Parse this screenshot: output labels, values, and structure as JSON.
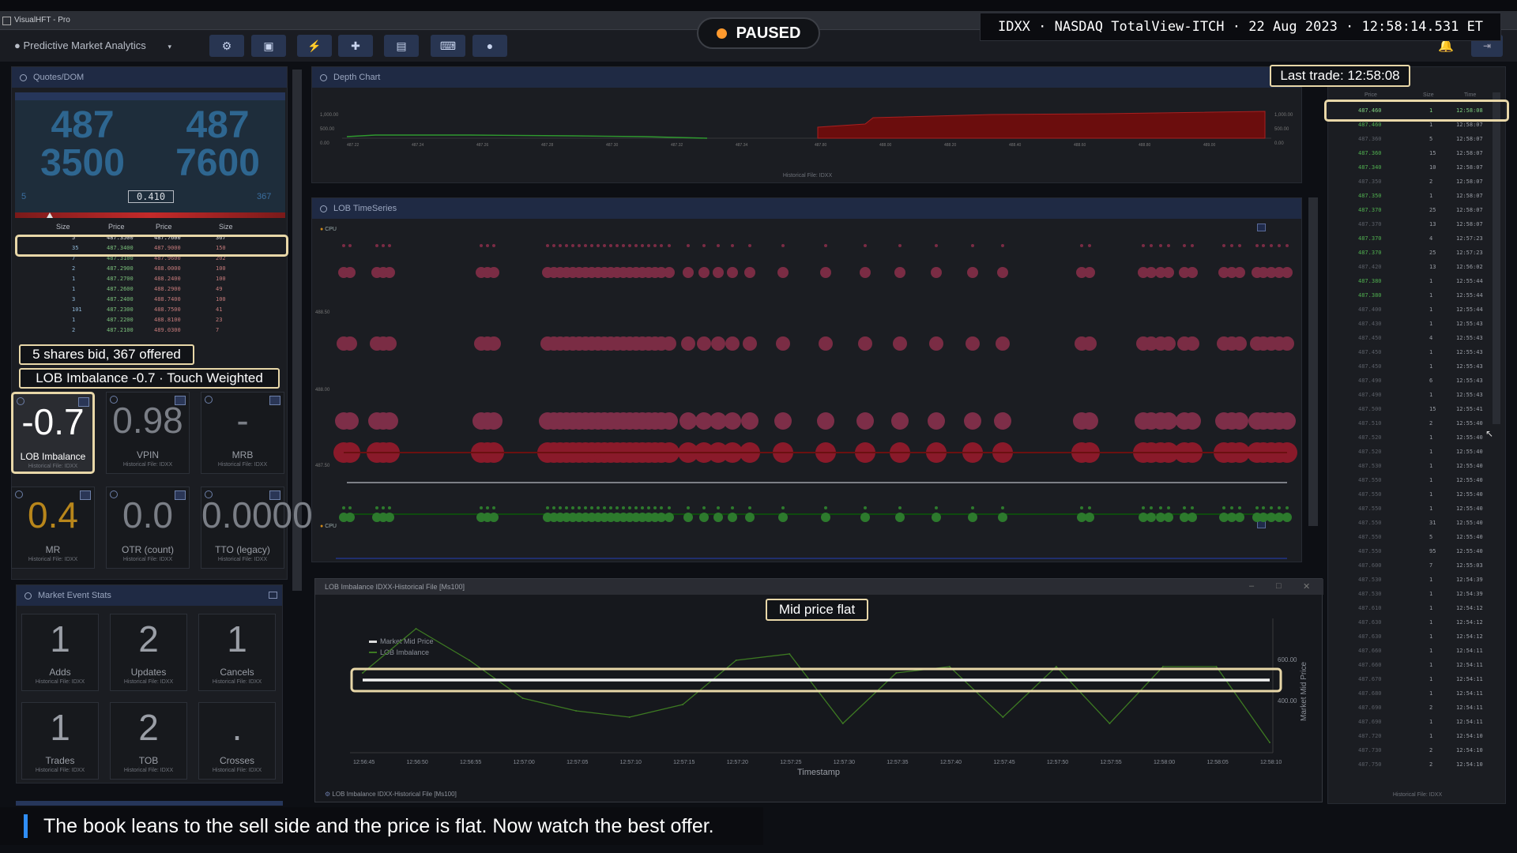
{
  "window": {
    "title": "VisualHFT - Pro"
  },
  "toolbar": {
    "app_name": "Predictive Market Analytics",
    "buttons": [
      "gear-icon",
      "monitor-icon",
      "bolt-icon",
      "puzzle-icon",
      "chart-icon",
      "keyboard-icon",
      "user-icon"
    ]
  },
  "status": {
    "paused_label": "PAUSED",
    "info_bar": "IDXX · NASDAQ TotalView-ITCH · 22 Aug 2023 · 12:58:14.531 ET",
    "dot_color": "#ff9a2e"
  },
  "quotes": {
    "title": "Quotes/DOM",
    "bid_price_top": "487",
    "bid_price_bottom": "3500",
    "ask_price_top": "487",
    "ask_price_bottom": "7600",
    "spread": "0.410",
    "bid_size": "5",
    "ask_size": "367",
    "headers": [
      "Size",
      "Price",
      "Price",
      "Size"
    ],
    "rows": [
      [
        "5",
        "487.3500",
        "487.7600",
        "367"
      ],
      [
        "35",
        "487.3400",
        "487.9000",
        "150"
      ],
      [
        "7",
        "487.3100",
        "487.9600",
        "202"
      ],
      [
        "2",
        "487.2900",
        "488.0000",
        "100"
      ],
      [
        "1",
        "487.2700",
        "488.2400",
        "100"
      ],
      [
        "1",
        "487.2600",
        "488.2900",
        "49"
      ],
      [
        "3",
        "487.2400",
        "488.7400",
        "100"
      ],
      [
        "101",
        "487.2300",
        "488.7500",
        "41"
      ],
      [
        "1",
        "487.2200",
        "488.8100",
        "23"
      ],
      [
        "2",
        "487.2100",
        "489.0300",
        "7"
      ]
    ]
  },
  "callouts": {
    "quotes_note": "5 shares bid, 367 offered",
    "lob_note": "LOB Imbalance -0.7 · Touch Weighted",
    "last_trade": "Last trade: 12:58:08",
    "mid_flat": "Mid price flat"
  },
  "metrics": [
    {
      "value": "-0.7",
      "label": "LOB Imbalance",
      "source": "Historical File: IDXX",
      "color": "#ffffff"
    },
    {
      "value": "0.98",
      "label": "VPIN",
      "source": "Historical File: IDXX",
      "color": "#7a7e86"
    },
    {
      "value": "-",
      "label": "MRB",
      "source": "Historical File: IDXX",
      "color": "#7a7e86"
    },
    {
      "value": "0.4",
      "label": "MR",
      "source": "Historical File: IDXX",
      "color": "#b8861b"
    },
    {
      "value": "0.0",
      "label": "OTR (count)",
      "source": "Historical File: IDXX",
      "color": "#7a7e86"
    },
    {
      "value": "0.0000",
      "label": "TTO (legacy)",
      "source": "Historical File: IDXX",
      "color": "#7a7e86"
    }
  ],
  "market_stats": {
    "title": "Market Event Stats",
    "items": [
      {
        "value": "1",
        "label": "Adds",
        "source": "Historical File: IDXX"
      },
      {
        "value": "2",
        "label": "Updates",
        "source": "Historical File: IDXX"
      },
      {
        "value": "1",
        "label": "Cancels",
        "source": "Historical File: IDXX"
      },
      {
        "value": "1",
        "label": "Trades",
        "source": "Historical File: IDXX"
      },
      {
        "value": "2",
        "label": "TOB",
        "source": "Historical File: IDXX"
      },
      {
        "value": ".",
        "label": "Crosses",
        "source": "Historical File: IDXX"
      }
    ]
  },
  "depth": {
    "title": "Depth Chart",
    "source": "Historical File: IDXX",
    "y_ticks": [
      "1,000.00",
      "500.00",
      "0.00"
    ],
    "x_ticks": [
      "487.22",
      "487.24",
      "487.26",
      "487.28",
      "487.30",
      "487.32",
      "487.34",
      "487.80",
      "488.00",
      "488.20",
      "488.40",
      "488.60",
      "488.80",
      "489.00"
    ]
  },
  "lob_ts": {
    "title": "LOB TimeSeries",
    "badge": "CPU",
    "y_ticks": [
      "488.50",
      "488.00",
      "487.50"
    ]
  },
  "imbalance_chart": {
    "window_title": "LOB Imbalance IDXX-Historical File [Ms100]",
    "footer": "LOB Imbalance IDXX-Historical File [Ms100]",
    "legend": [
      "Market Mid Price",
      "LOB Imbalance"
    ],
    "xlabel": "Timestamp",
    "ylabel_right": "Market Mid Price",
    "y_ticks_right": [
      "600.00",
      "400.00"
    ],
    "x_ticks": [
      "12:56:45",
      "12:56:50",
      "12:56:55",
      "12:57:00",
      "12:57:05",
      "12:57:10",
      "12:57:15",
      "12:57:20",
      "12:57:25",
      "12:57:30",
      "12:57:35",
      "12:57:40",
      "12:57:45",
      "12:57:50",
      "12:57:55",
      "12:58:00",
      "12:58:05",
      "12:58:10"
    ]
  },
  "chart_data": {
    "type": "line",
    "xlabel": "Timestamp",
    "ylabel": "Market Mid Price",
    "x": [
      "12:56:45",
      "12:56:50",
      "12:56:55",
      "12:57:00",
      "12:57:05",
      "12:57:10",
      "12:57:15",
      "12:57:20",
      "12:57:25",
      "12:57:30",
      "12:57:35",
      "12:57:40",
      "12:57:45",
      "12:57:50",
      "12:57:55",
      "12:58:00",
      "12:58:05",
      "12:58:10"
    ],
    "series": [
      {
        "name": "Market Mid Price",
        "values": [
          487.55,
          487.55,
          487.55,
          487.55,
          487.55,
          487.55,
          487.55,
          487.55,
          487.55,
          487.55,
          487.55,
          487.55,
          487.55,
          487.55,
          487.55,
          487.55,
          487.55,
          487.55
        ]
      },
      {
        "name": "LOB Imbalance",
        "values": [
          0.2,
          0.9,
          0.4,
          -0.2,
          -0.4,
          -0.5,
          -0.3,
          0.4,
          0.5,
          -0.6,
          0.2,
          0.3,
          -0.5,
          0.3,
          -0.6,
          0.3,
          0.3,
          -0.9
        ]
      }
    ]
  },
  "trades": {
    "headers": [
      "Price",
      "Size",
      "Time"
    ],
    "footer": "Historical File: IDXX",
    "rows": [
      [
        "487.460",
        "1",
        "12:58:08"
      ],
      [
        "487.460",
        "1",
        "12:58:07"
      ],
      [
        "487.360",
        "5",
        "12:58:07"
      ],
      [
        "487.360",
        "15",
        "12:58:07"
      ],
      [
        "487.340",
        "10",
        "12:58:07"
      ],
      [
        "487.350",
        "2",
        "12:58:07"
      ],
      [
        "487.350",
        "1",
        "12:58:07"
      ],
      [
        "487.370",
        "25",
        "12:58:07"
      ],
      [
        "487.370",
        "13",
        "12:58:07"
      ],
      [
        "487.370",
        "4",
        "12:57:23"
      ],
      [
        "487.370",
        "25",
        "12:57:23"
      ],
      [
        "487.420",
        "13",
        "12:56:02"
      ],
      [
        "487.380",
        "1",
        "12:55:44"
      ],
      [
        "487.380",
        "1",
        "12:55:44"
      ],
      [
        "487.400",
        "1",
        "12:55:44"
      ],
      [
        "487.430",
        "1",
        "12:55:43"
      ],
      [
        "487.450",
        "4",
        "12:55:43"
      ],
      [
        "487.450",
        "1",
        "12:55:43"
      ],
      [
        "487.450",
        "1",
        "12:55:43"
      ],
      [
        "487.490",
        "6",
        "12:55:43"
      ],
      [
        "487.490",
        "1",
        "12:55:43"
      ],
      [
        "487.500",
        "15",
        "12:55:41"
      ],
      [
        "487.510",
        "2",
        "12:55:40"
      ],
      [
        "487.520",
        "1",
        "12:55:40"
      ],
      [
        "487.520",
        "1",
        "12:55:40"
      ],
      [
        "487.530",
        "1",
        "12:55:40"
      ],
      [
        "487.550",
        "1",
        "12:55:40"
      ],
      [
        "487.550",
        "1",
        "12:55:40"
      ],
      [
        "487.550",
        "1",
        "12:55:40"
      ],
      [
        "487.550",
        "31",
        "12:55:40"
      ],
      [
        "487.550",
        "5",
        "12:55:40"
      ],
      [
        "487.550",
        "95",
        "12:55:40"
      ],
      [
        "487.600",
        "7",
        "12:55:03"
      ],
      [
        "487.530",
        "1",
        "12:54:39"
      ],
      [
        "487.530",
        "1",
        "12:54:39"
      ],
      [
        "487.610",
        "1",
        "12:54:12"
      ],
      [
        "487.630",
        "1",
        "12:54:12"
      ],
      [
        "487.630",
        "1",
        "12:54:12"
      ],
      [
        "487.660",
        "1",
        "12:54:11"
      ],
      [
        "487.660",
        "1",
        "12:54:11"
      ],
      [
        "487.670",
        "1",
        "12:54:11"
      ],
      [
        "487.680",
        "1",
        "12:54:11"
      ],
      [
        "487.690",
        "2",
        "12:54:11"
      ],
      [
        "487.690",
        "1",
        "12:54:11"
      ],
      [
        "487.720",
        "1",
        "12:54:10"
      ],
      [
        "487.730",
        "2",
        "12:54:10"
      ],
      [
        "487.750",
        "2",
        "12:54:10"
      ]
    ]
  },
  "caption": "The book leans to the sell side and the price is flat. Now watch the best offer."
}
